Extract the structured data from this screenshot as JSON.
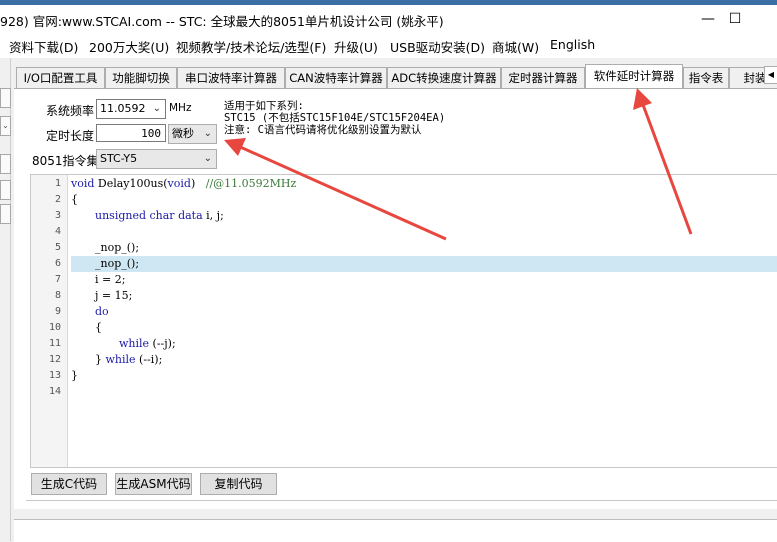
{
  "window": {
    "title": "928) 官网:www.STCAI.com  -- STC: 全球最大的8051单片机设计公司 (姚永平)",
    "minimize": "—",
    "maximize": "☐"
  },
  "menu": [
    "资料下载(D)",
    "200万大奖(U)",
    "视频教学/技术论坛/选型(F)",
    "升级(U)",
    "USB驱动安装(D)",
    "商城(W)",
    "English"
  ],
  "tabs": [
    "I/O口配置工具",
    "功能脚切换",
    "串口波特率计算器",
    "CAN波特率计算器",
    "ADC转换速度计算器",
    "定时器计算器",
    "软件延时计算器",
    "指令表",
    "封装"
  ],
  "active_tab": "软件延时计算器",
  "form": {
    "freq_label": "系统频率",
    "freq_value": "11.0592",
    "freq_unit": "MHz",
    "delay_label": "定时长度",
    "delay_value": "100",
    "delay_unit": "微秒",
    "isa_label": "8051指令集",
    "isa_value": "STC-Y5"
  },
  "info": {
    "line1": "适用于如下系列:",
    "line2": "STC15 (不包括STC15F104E/STC15F204EA)",
    "line3": "注意: C语言代码请将优化级别设置为默认"
  },
  "code": {
    "highlight_line": 6,
    "line_numbers": [
      "1",
      "2",
      "3",
      "4",
      "5",
      "6",
      "7",
      "8",
      "9",
      "10",
      "11",
      "12",
      "13",
      "14"
    ],
    "l1_kw": "void",
    "l1_txt": " Delay100us(",
    "l1_kw2": "void",
    "l1_txt2": ")",
    "l1_cm": "//@11.0592MHz",
    "l2": "{",
    "l3_kw": "unsigned char data",
    "l3_txt": " i, j;",
    "l5": "_nop_();",
    "l6": "_nop_();",
    "l7": "i = 2;",
    "l8": "j = 15;",
    "l9": "do",
    "l10": "{",
    "l11_kw": "while",
    "l11_txt": " (--j);",
    "l12_txt": "} ",
    "l12_kw": "while",
    "l12_txt2": " (--i);",
    "l13": "}"
  },
  "buttons": {
    "gen_c": "生成C代码",
    "gen_asm": "生成ASM代码",
    "copy": "复制代码"
  },
  "colors": {
    "arrow": "#e8473f",
    "highlight": "#cfe6f3",
    "keyword": "#1a1aa6",
    "comment": "#3a7a3a"
  }
}
